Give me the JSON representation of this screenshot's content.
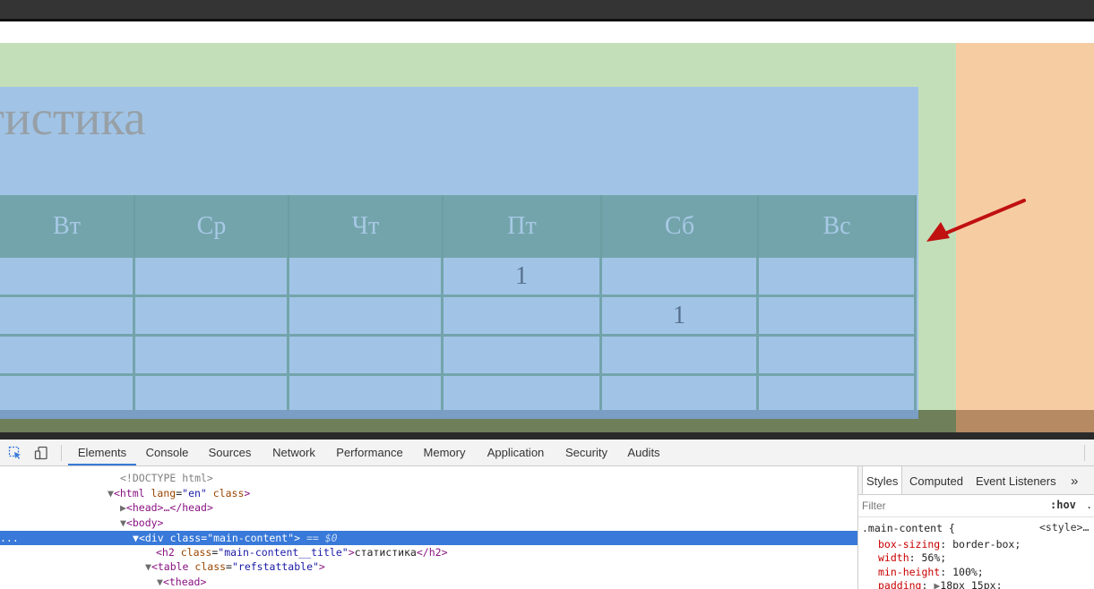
{
  "page": {
    "title": "атистика",
    "table": {
      "headers": [
        "Вт",
        "Ср",
        "Чт",
        "Пт",
        "Сб",
        "Вс"
      ],
      "rows": [
        [
          "",
          "",
          "",
          "1",
          "",
          ""
        ],
        [
          "",
          "",
          "",
          "",
          "1",
          ""
        ],
        [
          "",
          "",
          "",
          "",
          "",
          ""
        ],
        [
          "",
          "",
          "",
          "",
          "",
          ""
        ]
      ]
    }
  },
  "colors": {
    "green_area": "#c3dfba",
    "orange_area": "#f6cda3",
    "main_content": "#a1c4e6",
    "table_header": "#73a4ab",
    "arrow": "#c01010"
  },
  "devtools": {
    "toolbar": {
      "icons": [
        "inspect-element-icon",
        "device-toggle-icon"
      ],
      "tabs": [
        "Elements",
        "Console",
        "Sources",
        "Network",
        "Performance",
        "Memory",
        "Application",
        "Security",
        "Audits"
      ],
      "active_tab": "Elements"
    },
    "elements": {
      "ellipsis": "...",
      "lines": [
        {
          "doctype": "<!DOCTYPE html>"
        },
        {
          "open": "<html",
          "attr1": "lang",
          "val1": "\"en\"",
          "attr2": "class",
          "close": ">"
        },
        {
          "text": "<head>…</head>"
        },
        {
          "text": "<body>"
        },
        {
          "open": "<div",
          "attr1": "class",
          "val1": "\"main-content\"",
          "close": ">",
          "suffix": "== $0"
        },
        {
          "open": "<h2",
          "attr1": "class",
          "val1": "\"main-content__title\"",
          "close": ">",
          "inner": "статистика",
          "end": "</h2>"
        },
        {
          "open": "<table",
          "attr1": "class",
          "val1": "\"refstattable\"",
          "close": ">"
        },
        {
          "text": "<thead>"
        }
      ]
    },
    "styles": {
      "tabs": [
        "Styles",
        "Computed",
        "Event Listeners"
      ],
      "more": "»",
      "filter_placeholder": "Filter",
      "hov": ":hov",
      "hov_extra": ".",
      "rule_selector": ".main-content {",
      "rule_source": "<style>…",
      "props": [
        {
          "name": "box-sizing",
          "value": "border-box;"
        },
        {
          "name": "width",
          "value": "56%;"
        },
        {
          "name": "min-height",
          "value": "100%;"
        },
        {
          "name": "padding",
          "value": "18px 15px;"
        }
      ]
    }
  }
}
